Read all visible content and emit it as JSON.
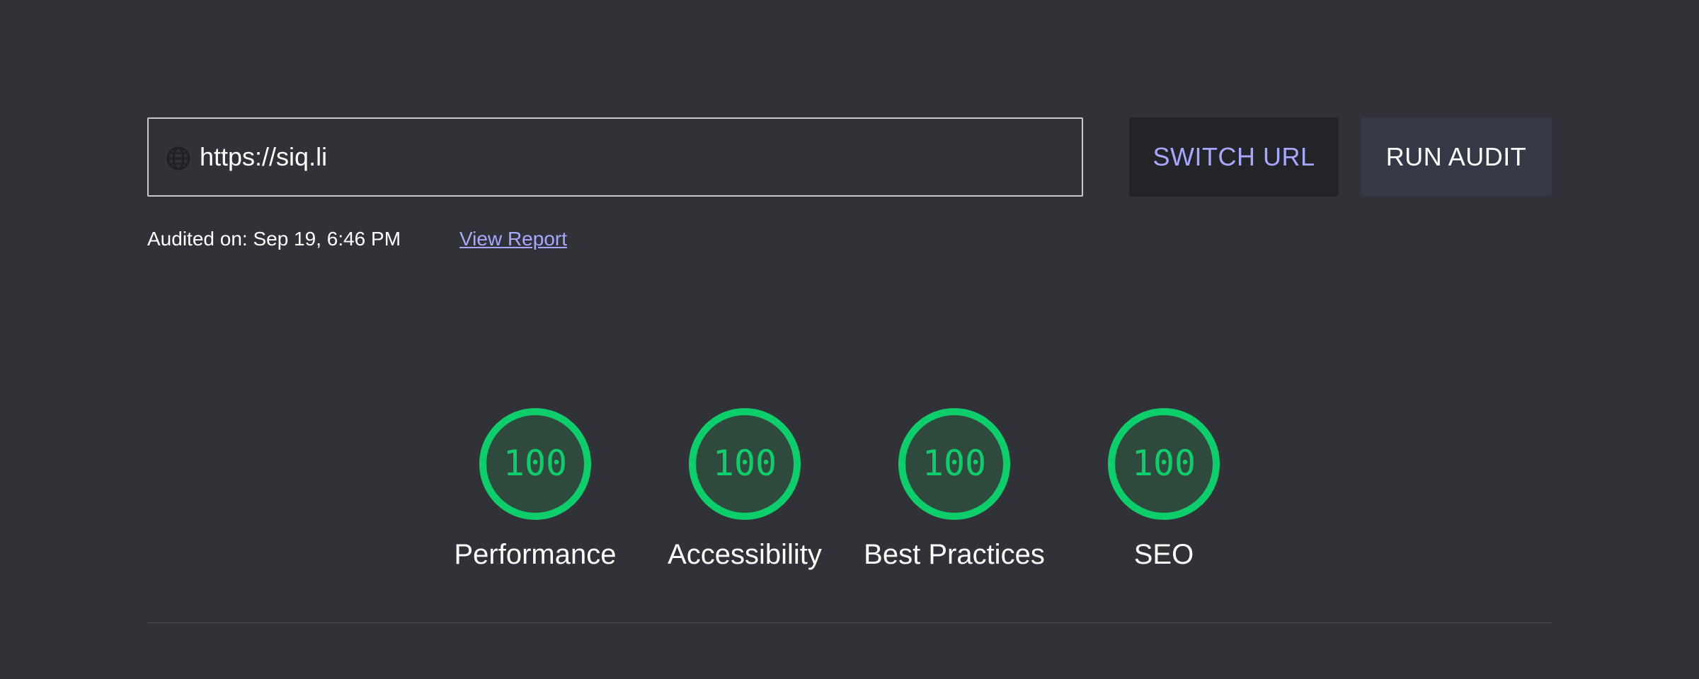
{
  "url_bar": {
    "value": "https://siq.li",
    "icon": "globe-icon"
  },
  "buttons": {
    "switch_url": "SWITCH URL",
    "run_audit": "RUN AUDIT"
  },
  "audit_info": {
    "audited_on": "Audited on: Sep 19, 6:46 PM",
    "view_report": "View Report"
  },
  "scores": [
    {
      "label": "Performance",
      "value": "100"
    },
    {
      "label": "Accessibility",
      "value": "100"
    },
    {
      "label": "Best Practices",
      "value": "100"
    },
    {
      "label": "SEO",
      "value": "100"
    }
  ],
  "colors": {
    "background": "#313237",
    "pass": "#0cce6b",
    "pass_fill": "#2d4a3c",
    "link": "#a6a8ff"
  }
}
